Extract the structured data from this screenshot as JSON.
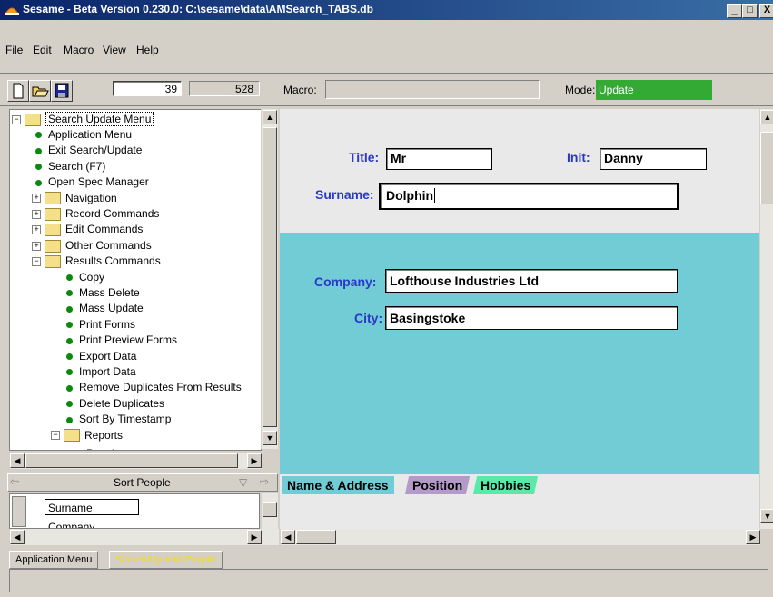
{
  "window": {
    "title": "Sesame - Beta Version 0.230.0: C:\\sesame\\data\\AMSearch_TABS.db",
    "controls": [
      "_",
      "□",
      "X"
    ]
  },
  "menu": [
    "File",
    "Edit",
    "Macro",
    "View",
    "Help"
  ],
  "toolbar": {
    "record_number": "39",
    "record_count": "528",
    "macro_label": "Macro:",
    "macro_value": "",
    "mode_label": "Mode:",
    "mode_value": "Update",
    "mode_color": "#33aa33"
  },
  "tree": {
    "root": "Search Update Menu",
    "items": [
      {
        "label": "Application Menu",
        "kind": "leaf"
      },
      {
        "label": "Exit Search/Update",
        "kind": "leaf"
      },
      {
        "label": "Search (F7)",
        "kind": "leaf"
      },
      {
        "label": "Open Spec Manager",
        "kind": "leaf"
      },
      {
        "label": "Navigation",
        "kind": "folder-collapsed"
      },
      {
        "label": "Record Commands",
        "kind": "folder-collapsed"
      },
      {
        "label": "Edit Commands",
        "kind": "folder-collapsed"
      },
      {
        "label": "Other Commands",
        "kind": "folder-collapsed"
      },
      {
        "label": "Results Commands",
        "kind": "folder-expanded"
      },
      {
        "label": "Copy",
        "kind": "leaf-sub"
      },
      {
        "label": "Mass Delete",
        "kind": "leaf-sub"
      },
      {
        "label": "Mass Update",
        "kind": "leaf-sub"
      },
      {
        "label": "Print Forms",
        "kind": "leaf-sub"
      },
      {
        "label": "Print Preview Forms",
        "kind": "leaf-sub"
      },
      {
        "label": "Export Data",
        "kind": "leaf-sub"
      },
      {
        "label": "Import Data",
        "kind": "leaf-sub"
      },
      {
        "label": "Remove Duplicates From Results",
        "kind": "leaf-sub"
      },
      {
        "label": "Delete Duplicates",
        "kind": "leaf-sub"
      },
      {
        "label": "Sort By Timestamp",
        "kind": "leaf-sub"
      },
      {
        "label": "Reports",
        "kind": "folder-expanded-sub"
      },
      {
        "label": "People",
        "kind": "partial"
      }
    ]
  },
  "sort_panel": {
    "title": "Sort People",
    "items": [
      "Surname",
      "Company"
    ]
  },
  "form": {
    "title_label": "Title:",
    "title_value": "Mr",
    "init_label": "Init:",
    "init_value": "Danny",
    "surname_label": "Surname:",
    "surname_value": "Dolphin",
    "company_label": "Company:",
    "company_value": "Lofthouse Industries Ltd",
    "city_label": "City:",
    "city_value": "Basingstoke",
    "tabs": [
      {
        "label": "Name & Address",
        "color": "#72ccd5"
      },
      {
        "label": "Position",
        "color": "#b49ac8"
      },
      {
        "label": "Hobbies",
        "color": "#5ce8a8"
      }
    ]
  },
  "bottom_tabs": [
    {
      "label": "Application Menu",
      "active": false
    },
    {
      "label": "Search/Update People",
      "active": true
    }
  ]
}
